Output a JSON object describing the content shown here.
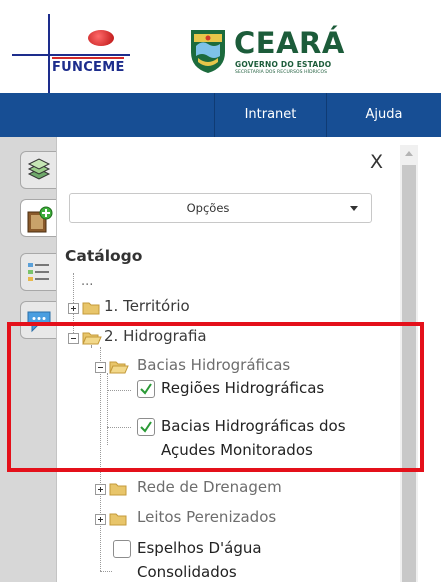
{
  "header": {
    "funceme_logo_text": "FUNCEME",
    "ceara_title": "CEARÁ",
    "ceara_subtitle": "GOVERNO DO ESTADO",
    "ceara_subtitle2": "SECRETARIA DOS RECURSOS HÍDRICOS"
  },
  "nav": {
    "items": [
      "Intranet",
      "Ajuda"
    ]
  },
  "toolbar": {
    "buttons": [
      {
        "icon": "layers-icon"
      },
      {
        "icon": "add-layer-icon"
      },
      {
        "icon": "legend-icon"
      },
      {
        "icon": "chat-icon"
      }
    ]
  },
  "panel": {
    "close_label": "X",
    "options_label": "Opções",
    "catalog_title": "Catálogo",
    "tree": {
      "ellipsis": "...",
      "territorio": "1. Território",
      "hidrografia": "2. Hidrografia",
      "bacias": "Bacias Hidrográficas",
      "regioes": "Regiões Hidrográficas",
      "bacias_acudes_line1": "Bacias Hidrográficas dos",
      "bacias_acudes_line2": "Açudes Monitorados",
      "rede": "Rede de Drenagem",
      "leitos": "Leitos Perenizados",
      "espelhos_line1": "Espelhos D'água",
      "espelhos_line2": "Consolidados"
    }
  },
  "colors": {
    "navbar": "#174e94",
    "highlight": "#e4101a",
    "check": "#2b9a36",
    "folder": "#e8c56a"
  }
}
